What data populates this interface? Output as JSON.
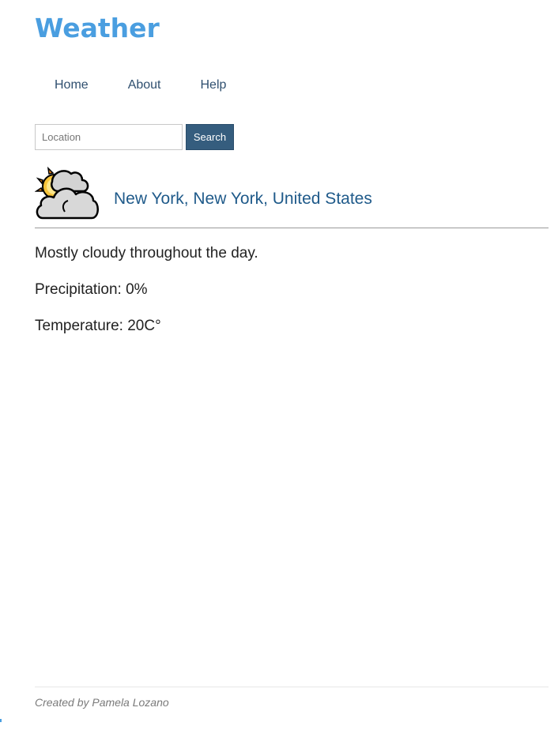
{
  "app": {
    "title": "Weather",
    "accent_color": "#4a9ee0"
  },
  "nav": {
    "items": [
      {
        "label": "Home"
      },
      {
        "label": "About"
      },
      {
        "label": "Help"
      }
    ]
  },
  "search": {
    "placeholder": "Location",
    "value": "",
    "button_label": "Search"
  },
  "forecast": {
    "icon": "partly-cloudy-icon",
    "location": "New York, New York, United States",
    "summary": "Mostly cloudy throughout the day.",
    "precipitation": "Precipitation: 0%",
    "temperature": "Temperature: 20C°"
  },
  "footer": {
    "credit": "Created by Pamela Lozano"
  }
}
